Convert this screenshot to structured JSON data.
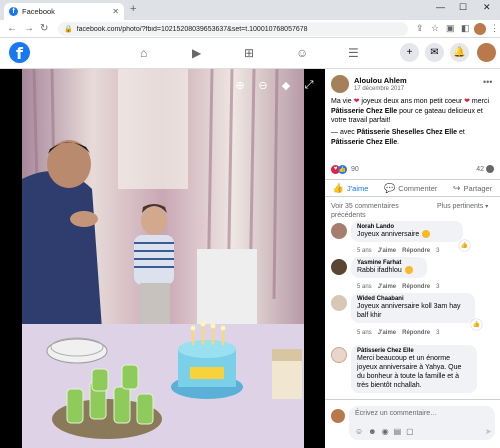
{
  "browser": {
    "tab_title": "Facebook",
    "url": "facebook.com/photo/?fbid=10215208039653637&set=t.100010768057678"
  },
  "post": {
    "author": "Aloulou Ahlem",
    "date": "17 décembre 2017",
    "caption_pre": "Ma vie ",
    "caption_mid": " joyeux deux ans mon petit coeur ",
    "caption_post": " merci ",
    "mention": "Pâtisserie Chez Elle",
    "caption_end": " pour ce gateau delicieux et votre travail parfait!",
    "with_pre": "— avec ",
    "with_1": "Pâtisserie Sheselles Chez Elle",
    "with_mid": " et ",
    "with_2": "Pâtisserie Chez Elle",
    "with_end": ".",
    "reactions_count": "90",
    "comments_count": "42"
  },
  "actions": {
    "like": "J'aime",
    "comment": "Commenter",
    "share": "Partager"
  },
  "comments_header": {
    "previous": "Voir 35 commentaires précédents",
    "sort": "Plus pertinents"
  },
  "comments": [
    {
      "name": "Norah Lando",
      "text": "Joyeux anniversaire",
      "time": "5 ans",
      "like": "J'aime",
      "reply": "Répondre",
      "count": "3"
    },
    {
      "name": "Yasmine Farhat",
      "text": "Rabbi ifadhlou",
      "time": "5 ans",
      "like": "J'aime",
      "reply": "Répondre",
      "count": "3"
    },
    {
      "name": "Wided Chaabani",
      "text": "Joyeux anniversaire koll 3am hay balf khir",
      "time": "5 ans",
      "like": "J'aime",
      "reply": "Répondre",
      "count": "3"
    },
    {
      "name": "Pâtisserie Chez Elle",
      "text": "Merci beaucoup et un énorme joyeux anniversaire à Yahya. Que du bonheur à toute la famille et à très bientôt nchallah.",
      "time": "5 ans",
      "like": "J'aime",
      "reply": "Répondre"
    }
  ],
  "compose": {
    "placeholder": "Écrivez un commentaire…"
  },
  "colors": {
    "facebook_blue": "#1877f2",
    "love_red": "#e41e3f",
    "bubble_bg": "#f0f2f5"
  }
}
